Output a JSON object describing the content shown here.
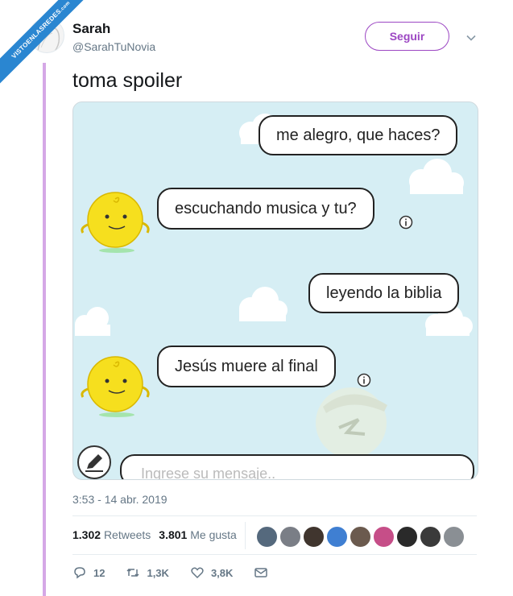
{
  "ribbon": {
    "text": "VISTOENLASREDES",
    "suffix": ".com"
  },
  "author": {
    "name": "Sarah",
    "handle": "@SarahTuNovia"
  },
  "follow_label": "Seguir",
  "tweet_text": "toma spoiler",
  "chat": {
    "messages": [
      {
        "side": "right",
        "text": "me alegro, que haces?"
      },
      {
        "side": "left",
        "text": "escuchando musica y tu?"
      },
      {
        "side": "right",
        "text": "leyendo la biblia"
      },
      {
        "side": "left",
        "text": "Jesús muere al final"
      }
    ],
    "input_placeholder": "Ingrese su mensaje.."
  },
  "timestamp": "3:53 - 14 abr. 2019",
  "stats": {
    "retweets_count": "1.302",
    "retweets_label": "Retweets",
    "likes_count": "3.801",
    "likes_label": "Me gusta"
  },
  "likers_colors": [
    "#55697d",
    "#7a7e86",
    "#40352e",
    "#3f7fd2",
    "#6b5a4e",
    "#c64e88",
    "#2a2a2a",
    "#3a3a3a",
    "#8a8f94"
  ],
  "actions": {
    "replies": "12",
    "retweets": "1,3K",
    "likes": "3,8K"
  },
  "colors": {
    "accent": "#9c47c3",
    "thread": "#d5a8e6",
    "muted": "#657786",
    "ribbon": "#2a86d1"
  }
}
